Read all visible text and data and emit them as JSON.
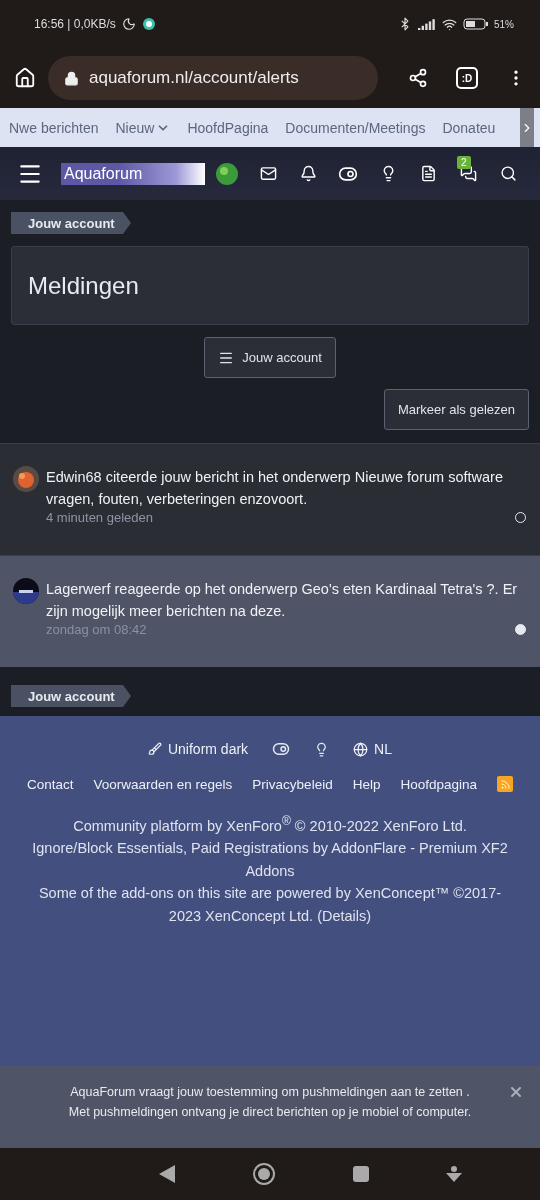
{
  "status_bar": {
    "time": "16:56 | 0,0KB/s",
    "battery": "51%"
  },
  "browser": {
    "url": "aquaforum.nl/account/alerts",
    "tabs_label": ":D"
  },
  "nav_tabs": [
    {
      "label": "Nwe berichten",
      "dropdown": false
    },
    {
      "label": "Nieuw",
      "dropdown": true
    },
    {
      "label": "HoofdPagina",
      "dropdown": false
    },
    {
      "label": "Documenten/Meetings",
      "dropdown": false
    },
    {
      "label": "Donateu",
      "dropdown": false
    }
  ],
  "header": {
    "logo": "Aquaforum",
    "conversations_badge": "2"
  },
  "breadcrumb": "Jouw account",
  "title": "Meldingen",
  "account_button": "Jouw account",
  "mark_read_button": "Markeer als gelezen",
  "alerts": [
    {
      "text": "Edwin68 citeerde jouw bericht in het onderwerp Nieuwe forum software vragen, fouten, verbeteringen enzovoort.",
      "time": "4 minuten geleden",
      "unread": false
    },
    {
      "text": "Lagerwerf reageerde op het onderwerp Geo's eten Kardinaal Tetra's ?. Er zijn mogelijk meer berichten na deze.",
      "time": "zondag om 08:42",
      "unread": true
    }
  ],
  "breadcrumb_bottom": "Jouw account",
  "footer": {
    "style": "Uniform dark",
    "language": "NL",
    "links": [
      "Contact",
      "Voorwaarden en regels",
      "Privacybeleid",
      "Help",
      "Hoofdpagina"
    ],
    "copyright": [
      "Community platform by XenForo$^{®}$ © 2010-2022 XenForo Ltd.",
      "Ignore/Block Essentials, Paid Registrations by AddonFlare - Premium XF2 Addons",
      "Some of the add-ons on this site are powered by XenConcept™ ©2017-2023 XenConcept Ltd. (Details)"
    ]
  },
  "push_notice": {
    "lines": [
      "AquaForum vraagt jouw toestemming om pushmeldingen aan te zetten .",
      "Met pushmeldingen ontvang je direct berichten op je mobiel of computer."
    ]
  }
}
